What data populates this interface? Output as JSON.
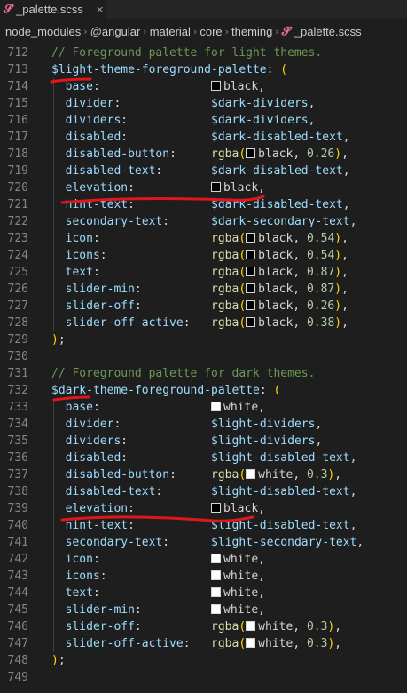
{
  "tab": {
    "file_name": "_palette.scss",
    "close_glyph": "×",
    "icon": "sass-file-icon"
  },
  "breadcrumb": {
    "items": [
      "node_modules",
      "@angular",
      "material",
      "core",
      "theming",
      "_palette.scss"
    ],
    "separator": "›"
  },
  "colors": {
    "annotation_stroke": "#e0161b",
    "swatch_black": "#000000",
    "swatch_white": "#ffffff"
  },
  "editor": {
    "lines": [
      {
        "n": "712",
        "tokens": [
          [
            "c-comment",
            "// Foreground palette for light themes."
          ]
        ]
      },
      {
        "n": "713",
        "tokens": [
          [
            "c-var",
            "$light-theme-foreground-palette"
          ],
          [
            "c-punct",
            ": "
          ],
          [
            "c-paren",
            "("
          ]
        ]
      },
      {
        "n": "714",
        "tokens": [
          [
            "c-key",
            "  base"
          ],
          [
            "c-punct",
            ":                "
          ],
          [
            "swatch",
            "#000000"
          ],
          [
            "c-val",
            "black"
          ],
          [
            "c-punct",
            ","
          ]
        ]
      },
      {
        "n": "715",
        "tokens": [
          [
            "c-key",
            "  divider"
          ],
          [
            "c-punct",
            ":             "
          ],
          [
            "c-var",
            "$dark-dividers"
          ],
          [
            "c-punct",
            ","
          ]
        ]
      },
      {
        "n": "716",
        "tokens": [
          [
            "c-key",
            "  dividers"
          ],
          [
            "c-punct",
            ":            "
          ],
          [
            "c-var",
            "$dark-dividers"
          ],
          [
            "c-punct",
            ","
          ]
        ]
      },
      {
        "n": "717",
        "tokens": [
          [
            "c-key",
            "  disabled"
          ],
          [
            "c-punct",
            ":            "
          ],
          [
            "c-var",
            "$dark-disabled-text"
          ],
          [
            "c-punct",
            ","
          ]
        ]
      },
      {
        "n": "718",
        "tokens": [
          [
            "c-key",
            "  disabled-button"
          ],
          [
            "c-punct",
            ":     "
          ],
          [
            "c-func",
            "rgba"
          ],
          [
            "c-paren",
            "("
          ],
          [
            "swatch",
            "#000000"
          ],
          [
            "c-val",
            "black"
          ],
          [
            "c-punct",
            ", "
          ],
          [
            "c-num",
            "0.26"
          ],
          [
            "c-paren",
            ")"
          ],
          [
            "c-punct",
            ","
          ]
        ]
      },
      {
        "n": "719",
        "tokens": [
          [
            "c-key",
            "  disabled-text"
          ],
          [
            "c-punct",
            ":       "
          ],
          [
            "c-var",
            "$dark-disabled-text"
          ],
          [
            "c-punct",
            ","
          ]
        ]
      },
      {
        "n": "720",
        "tokens": [
          [
            "c-key",
            "  elevation"
          ],
          [
            "c-punct",
            ":           "
          ],
          [
            "swatch",
            "#000000"
          ],
          [
            "c-val",
            "black"
          ],
          [
            "c-punct",
            ","
          ]
        ]
      },
      {
        "n": "721",
        "tokens": [
          [
            "c-key",
            "  hint-text"
          ],
          [
            "c-punct",
            ":           "
          ],
          [
            "c-var",
            "$dark-disabled-text"
          ],
          [
            "c-punct",
            ","
          ]
        ]
      },
      {
        "n": "722",
        "tokens": [
          [
            "c-key",
            "  secondary-text"
          ],
          [
            "c-punct",
            ":      "
          ],
          [
            "c-var",
            "$dark-secondary-text"
          ],
          [
            "c-punct",
            ","
          ]
        ]
      },
      {
        "n": "723",
        "tokens": [
          [
            "c-key",
            "  icon"
          ],
          [
            "c-punct",
            ":                "
          ],
          [
            "c-func",
            "rgba"
          ],
          [
            "c-paren",
            "("
          ],
          [
            "swatch",
            "#000000"
          ],
          [
            "c-val",
            "black"
          ],
          [
            "c-punct",
            ", "
          ],
          [
            "c-num",
            "0.54"
          ],
          [
            "c-paren",
            ")"
          ],
          [
            "c-punct",
            ","
          ]
        ]
      },
      {
        "n": "724",
        "tokens": [
          [
            "c-key",
            "  icons"
          ],
          [
            "c-punct",
            ":               "
          ],
          [
            "c-func",
            "rgba"
          ],
          [
            "c-paren",
            "("
          ],
          [
            "swatch",
            "#000000"
          ],
          [
            "c-val",
            "black"
          ],
          [
            "c-punct",
            ", "
          ],
          [
            "c-num",
            "0.54"
          ],
          [
            "c-paren",
            ")"
          ],
          [
            "c-punct",
            ","
          ]
        ]
      },
      {
        "n": "725",
        "tokens": [
          [
            "c-key",
            "  text"
          ],
          [
            "c-punct",
            ":                "
          ],
          [
            "c-func",
            "rgba"
          ],
          [
            "c-paren",
            "("
          ],
          [
            "swatch",
            "#000000"
          ],
          [
            "c-val",
            "black"
          ],
          [
            "c-punct",
            ", "
          ],
          [
            "c-num",
            "0.87"
          ],
          [
            "c-paren",
            ")"
          ],
          [
            "c-punct",
            ","
          ]
        ]
      },
      {
        "n": "726",
        "tokens": [
          [
            "c-key",
            "  slider-min"
          ],
          [
            "c-punct",
            ":          "
          ],
          [
            "c-func",
            "rgba"
          ],
          [
            "c-paren",
            "("
          ],
          [
            "swatch",
            "#000000"
          ],
          [
            "c-val",
            "black"
          ],
          [
            "c-punct",
            ", "
          ],
          [
            "c-num",
            "0.87"
          ],
          [
            "c-paren",
            ")"
          ],
          [
            "c-punct",
            ","
          ]
        ]
      },
      {
        "n": "727",
        "tokens": [
          [
            "c-key",
            "  slider-off"
          ],
          [
            "c-punct",
            ":          "
          ],
          [
            "c-func",
            "rgba"
          ],
          [
            "c-paren",
            "("
          ],
          [
            "swatch",
            "#000000"
          ],
          [
            "c-val",
            "black"
          ],
          [
            "c-punct",
            ", "
          ],
          [
            "c-num",
            "0.26"
          ],
          [
            "c-paren",
            ")"
          ],
          [
            "c-punct",
            ","
          ]
        ]
      },
      {
        "n": "728",
        "tokens": [
          [
            "c-key",
            "  slider-off-active"
          ],
          [
            "c-punct",
            ":   "
          ],
          [
            "c-func",
            "rgba"
          ],
          [
            "c-paren",
            "("
          ],
          [
            "swatch",
            "#000000"
          ],
          [
            "c-val",
            "black"
          ],
          [
            "c-punct",
            ", "
          ],
          [
            "c-num",
            "0.38"
          ],
          [
            "c-paren",
            ")"
          ],
          [
            "c-punct",
            ","
          ]
        ]
      },
      {
        "n": "729",
        "tokens": [
          [
            "c-paren",
            ")"
          ],
          [
            "c-punct",
            ";"
          ]
        ]
      },
      {
        "n": "730",
        "tokens": []
      },
      {
        "n": "731",
        "tokens": [
          [
            "c-comment",
            "// Foreground palette for dark themes."
          ]
        ]
      },
      {
        "n": "732",
        "tokens": [
          [
            "c-var",
            "$dark-theme-foreground-palette"
          ],
          [
            "c-punct",
            ": "
          ],
          [
            "c-paren",
            "("
          ]
        ]
      },
      {
        "n": "733",
        "tokens": [
          [
            "c-key",
            "  base"
          ],
          [
            "c-punct",
            ":                "
          ],
          [
            "swatch",
            "#ffffff"
          ],
          [
            "c-val",
            "white"
          ],
          [
            "c-punct",
            ","
          ]
        ]
      },
      {
        "n": "734",
        "tokens": [
          [
            "c-key",
            "  divider"
          ],
          [
            "c-punct",
            ":             "
          ],
          [
            "c-var",
            "$light-dividers"
          ],
          [
            "c-punct",
            ","
          ]
        ]
      },
      {
        "n": "735",
        "tokens": [
          [
            "c-key",
            "  dividers"
          ],
          [
            "c-punct",
            ":            "
          ],
          [
            "c-var",
            "$light-dividers"
          ],
          [
            "c-punct",
            ","
          ]
        ]
      },
      {
        "n": "736",
        "tokens": [
          [
            "c-key",
            "  disabled"
          ],
          [
            "c-punct",
            ":            "
          ],
          [
            "c-var",
            "$light-disabled-text"
          ],
          [
            "c-punct",
            ","
          ]
        ]
      },
      {
        "n": "737",
        "tokens": [
          [
            "c-key",
            "  disabled-button"
          ],
          [
            "c-punct",
            ":     "
          ],
          [
            "c-func",
            "rgba"
          ],
          [
            "c-paren",
            "("
          ],
          [
            "swatch",
            "#ffffff"
          ],
          [
            "c-val",
            "white"
          ],
          [
            "c-punct",
            ", "
          ],
          [
            "c-num",
            "0.3"
          ],
          [
            "c-paren",
            ")"
          ],
          [
            "c-punct",
            ","
          ]
        ]
      },
      {
        "n": "738",
        "tokens": [
          [
            "c-key",
            "  disabled-text"
          ],
          [
            "c-punct",
            ":       "
          ],
          [
            "c-var",
            "$light-disabled-text"
          ],
          [
            "c-punct",
            ","
          ]
        ]
      },
      {
        "n": "739",
        "tokens": [
          [
            "c-key",
            "  elevation"
          ],
          [
            "c-punct",
            ":           "
          ],
          [
            "swatch",
            "#000000"
          ],
          [
            "c-val",
            "black"
          ],
          [
            "c-punct",
            ","
          ]
        ]
      },
      {
        "n": "740",
        "tokens": [
          [
            "c-key",
            "  hint-text"
          ],
          [
            "c-punct",
            ":           "
          ],
          [
            "c-var",
            "$light-disabled-text"
          ],
          [
            "c-punct",
            ","
          ]
        ]
      },
      {
        "n": "741",
        "tokens": [
          [
            "c-key",
            "  secondary-text"
          ],
          [
            "c-punct",
            ":      "
          ],
          [
            "c-var",
            "$light-secondary-text"
          ],
          [
            "c-punct",
            ","
          ]
        ]
      },
      {
        "n": "742",
        "tokens": [
          [
            "c-key",
            "  icon"
          ],
          [
            "c-punct",
            ":                "
          ],
          [
            "swatch",
            "#ffffff"
          ],
          [
            "c-val",
            "white"
          ],
          [
            "c-punct",
            ","
          ]
        ]
      },
      {
        "n": "743",
        "tokens": [
          [
            "c-key",
            "  icons"
          ],
          [
            "c-punct",
            ":               "
          ],
          [
            "swatch",
            "#ffffff"
          ],
          [
            "c-val",
            "white"
          ],
          [
            "c-punct",
            ","
          ]
        ]
      },
      {
        "n": "744",
        "tokens": [
          [
            "c-key",
            "  text"
          ],
          [
            "c-punct",
            ":                "
          ],
          [
            "swatch",
            "#ffffff"
          ],
          [
            "c-val",
            "white"
          ],
          [
            "c-punct",
            ","
          ]
        ]
      },
      {
        "n": "745",
        "tokens": [
          [
            "c-key",
            "  slider-min"
          ],
          [
            "c-punct",
            ":          "
          ],
          [
            "swatch",
            "#ffffff"
          ],
          [
            "c-val",
            "white"
          ],
          [
            "c-punct",
            ","
          ]
        ]
      },
      {
        "n": "746",
        "tokens": [
          [
            "c-key",
            "  slider-off"
          ],
          [
            "c-punct",
            ":          "
          ],
          [
            "c-func",
            "rgba"
          ],
          [
            "c-paren",
            "("
          ],
          [
            "swatch",
            "#ffffff"
          ],
          [
            "c-val",
            "white"
          ],
          [
            "c-punct",
            ", "
          ],
          [
            "c-num",
            "0.3"
          ],
          [
            "c-paren",
            ")"
          ],
          [
            "c-punct",
            ","
          ]
        ]
      },
      {
        "n": "747",
        "tokens": [
          [
            "c-key",
            "  slider-off-active"
          ],
          [
            "c-punct",
            ":   "
          ],
          [
            "c-func",
            "rgba"
          ],
          [
            "c-paren",
            "("
          ],
          [
            "swatch",
            "#ffffff"
          ],
          [
            "c-val",
            "white"
          ],
          [
            "c-punct",
            ", "
          ],
          [
            "c-num",
            "0.3"
          ],
          [
            "c-paren",
            ")"
          ],
          [
            "c-punct",
            ","
          ]
        ]
      },
      {
        "n": "748",
        "tokens": [
          [
            "c-paren",
            ")"
          ],
          [
            "c-punct",
            ";"
          ]
        ]
      },
      {
        "n": "749",
        "tokens": []
      }
    ]
  }
}
